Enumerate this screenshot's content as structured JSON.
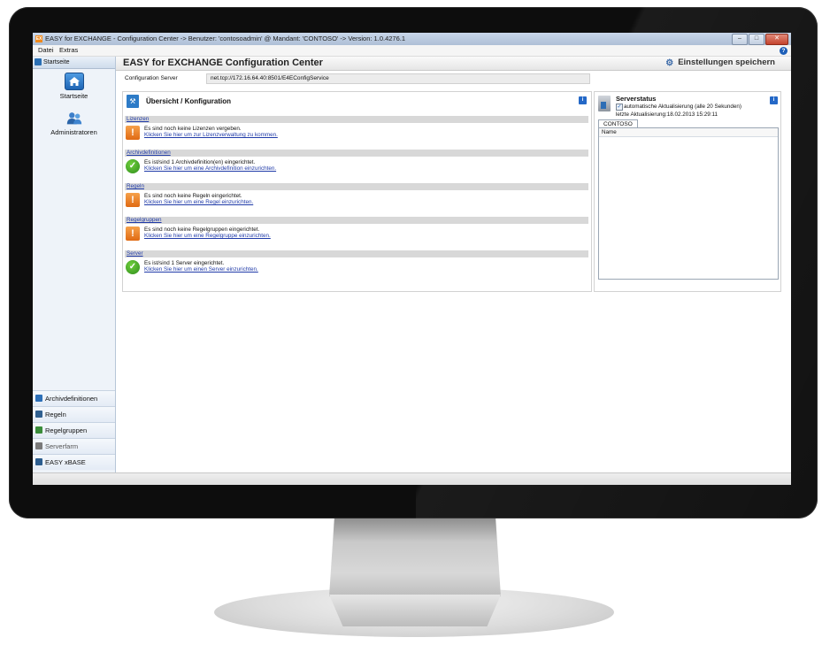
{
  "window": {
    "title": "EASY for EXCHANGE - Configuration Center -> Benutzer: 'contosoadmin' @ Mandant: 'CONTOSO' -> Version: 1.0.4276.1",
    "app_icon_text": "EX"
  },
  "menu": {
    "items": [
      "Datei",
      "Extras"
    ],
    "help": "?"
  },
  "sidebar": {
    "header": "Startseite",
    "big_items": [
      {
        "label": "Startseite",
        "icon": "home-icon"
      },
      {
        "label": "Administratoren",
        "icon": "users-icon"
      }
    ],
    "bottom_items": [
      {
        "label": "Archivdefinitionen",
        "icon": "archive-icon",
        "color": "#2c6fb7"
      },
      {
        "label": "Regeln",
        "icon": "rules-icon",
        "color": "#2f5f8f"
      },
      {
        "label": "Regelgruppen",
        "icon": "rule-groups-icon",
        "color": "#3a8d3a"
      },
      {
        "label": "Serverfarm",
        "icon": "server-farm-icon",
        "color": "#7a7a7a"
      },
      {
        "label": "EASY xBASE",
        "icon": "xbase-icon",
        "color": "#2c5d8f"
      }
    ]
  },
  "main": {
    "title": "EASY for EXCHANGE Configuration Center",
    "save_label": "Einstellungen speichern",
    "config_server_label": "Configuration Server",
    "config_server_value": "net.tcp://172.16.64.40:8501/E4EConfigService"
  },
  "overview": {
    "title": "Übersicht / Konfiguration",
    "info": "i",
    "sections": [
      {
        "header": "Lizenzen",
        "status": "warning",
        "text": "Es sind noch keine Lizenzen vergeben.",
        "link": "Klicken Sie hier um zur Lizenzverwaltung zu kommen."
      },
      {
        "header": "Archivdefinitionen",
        "status": "ok",
        "text": "Es ist/sind 1 Archivdefinition(en) eingerichtet.",
        "link": "Klicken Sie hier um eine Archivdefinition einzurichten."
      },
      {
        "header": "Regeln",
        "status": "warning",
        "text": "Es sind noch keine Regeln eingerichtet.",
        "link": "Klicken Sie hier um eine Regel einzurichten."
      },
      {
        "header": "Regelgruppen",
        "status": "warning",
        "text": "Es sind noch keine Regelgruppen eingerichtet.",
        "link": "Klicken Sie hier um eine Regelgruppe einzurichten."
      },
      {
        "header": "Server",
        "status": "ok",
        "text": "Es ist/sind 1 Server eingerichtet.",
        "link": "Klicken Sie hier um einen Server einzurichten."
      }
    ]
  },
  "server_status": {
    "title": "Serverstatus",
    "auto_refresh_label": "automatische Aktualisierung (alle 20 Sekunden)",
    "auto_refresh_checked": true,
    "last_update": "letzte Aktualisierung:18.02.2013 15:29:11",
    "tab": "CONTOSO",
    "column_header": "Name",
    "info": "i"
  },
  "colors": {
    "accent": "#2468c7",
    "warning": "#e87c1e",
    "ok": "#3ea526",
    "link": "#1f3aa8"
  }
}
